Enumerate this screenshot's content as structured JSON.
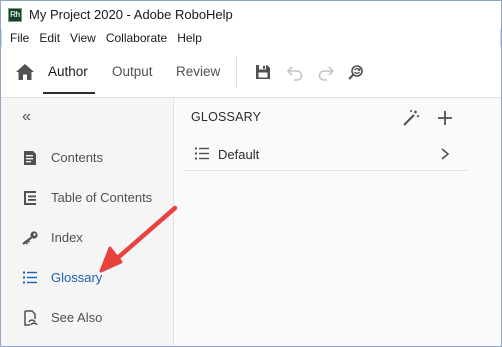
{
  "window": {
    "app_logo_text": "Rh",
    "title": "My Project 2020 - Adobe RoboHelp"
  },
  "menu": [
    "File",
    "Edit",
    "View",
    "Collaborate",
    "Help"
  ],
  "toolbar": {
    "tabs": [
      {
        "label": "Author",
        "active": true
      },
      {
        "label": "Output",
        "active": false
      },
      {
        "label": "Review",
        "active": false
      }
    ],
    "icons": [
      "home-icon",
      "save-icon",
      "undo-icon",
      "redo-icon",
      "search-replace-icon"
    ]
  },
  "sidebar": {
    "collapse_label": "«",
    "items": [
      {
        "label": "Contents",
        "icon": "contents-icon",
        "active": false
      },
      {
        "label": "Table of Contents",
        "icon": "toc-icon",
        "active": false
      },
      {
        "label": "Index",
        "icon": "key-icon",
        "active": false
      },
      {
        "label": "Glossary",
        "icon": "glossary-icon",
        "active": true
      },
      {
        "label": "See Also",
        "icon": "see-also-icon",
        "active": false
      }
    ]
  },
  "panel": {
    "title": "GLOSSARY",
    "rows": [
      {
        "label": "Default"
      }
    ]
  },
  "colors": {
    "accent": "#1f5fb2",
    "annotation_arrow": "#e8423f",
    "sidebar_bg": "#f5f5f5"
  }
}
